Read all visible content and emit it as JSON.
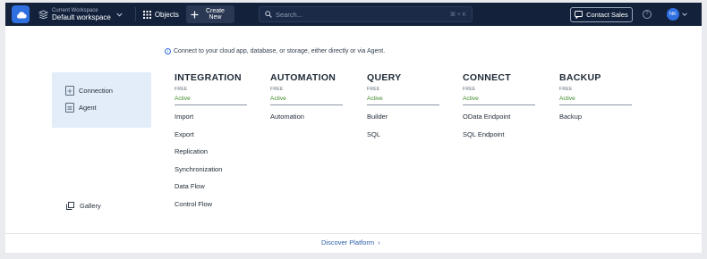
{
  "topbar": {
    "workspace_label": "Current Workspace",
    "workspace_name": "Default workspace",
    "objects_label": "Objects",
    "create_label_line1": "Create",
    "create_label_line2": "New",
    "search_placeholder": "Search...",
    "search_shortcut": "⌘ + K",
    "contact_label": "Contact Sales",
    "help_glyph": "?",
    "avatar_initials": "NK",
    "colors": {
      "bar": "#13213b",
      "brand": "#2f6fe0"
    }
  },
  "main": {
    "info_text": "Connect to your cloud app, database, or storage, either directly or via Agent.",
    "sidebar": {
      "items": [
        {
          "label": "Connection",
          "icon": "connection-icon"
        },
        {
          "label": "Agent",
          "icon": "agent-icon"
        }
      ],
      "gallery_label": "Gallery"
    },
    "columns": [
      {
        "title": "INTEGRATION",
        "plan": "FREE",
        "status": "Active",
        "items": [
          "Import",
          "Export",
          "Replication",
          "Synchronization",
          "Data Flow",
          "Control Flow"
        ]
      },
      {
        "title": "AUTOMATION",
        "plan": "FREE",
        "status": "Active",
        "items": [
          "Automation"
        ]
      },
      {
        "title": "QUERY",
        "plan": "FREE",
        "status": "Active",
        "items": [
          "Builder",
          "SQL"
        ]
      },
      {
        "title": "CONNECT",
        "plan": "FREE",
        "status": "Active",
        "items": [
          "OData Endpoint",
          "SQL Endpoint"
        ]
      },
      {
        "title": "BACKUP",
        "plan": "FREE",
        "status": "Active",
        "items": [
          "Backup"
        ]
      }
    ],
    "status_color": "#3e8a2a",
    "discover_label": "Discover Platform",
    "discover_chevron": "›"
  }
}
